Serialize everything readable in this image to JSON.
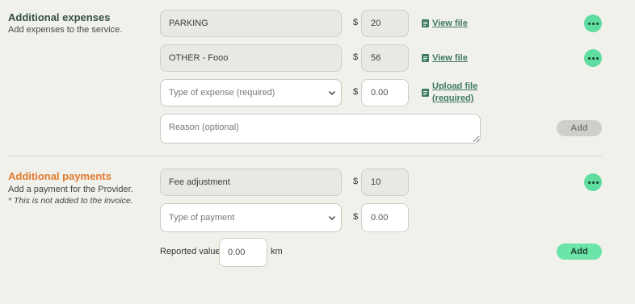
{
  "expenses": {
    "title": "Additional expenses",
    "description": "Add expenses to the service.",
    "rows": [
      {
        "type": "PARKING",
        "currency": "$",
        "amount": "20",
        "file_link": "View file"
      },
      {
        "type": "OTHER - Fooo",
        "currency": "$",
        "amount": "56",
        "file_link": "View file"
      }
    ],
    "new_row": {
      "type_placeholder": "Type of expense (required)",
      "currency": "$",
      "amount_placeholder": "0.00",
      "upload_line1": "Upload file",
      "upload_line2": "(required)",
      "reason_placeholder": "Reason (optional)",
      "add_label": "Add"
    }
  },
  "payments": {
    "title": "Additional payments",
    "description": "Add a payment for the Provider.",
    "note": "* This is not added to the invoice.",
    "rows": [
      {
        "type": "Fee adjustment",
        "currency": "$",
        "amount": "10"
      }
    ],
    "new_row": {
      "type_placeholder": "Type of payment",
      "currency": "$",
      "amount_placeholder": "0.00"
    },
    "reported": {
      "label": "Reported value",
      "placeholder": "0.00",
      "unit": "km"
    },
    "add_label": "Add"
  },
  "colors": {
    "accent_green": "#6be5a8",
    "title_orange": "#e07a2e",
    "link_green": "#3e7a5e"
  }
}
